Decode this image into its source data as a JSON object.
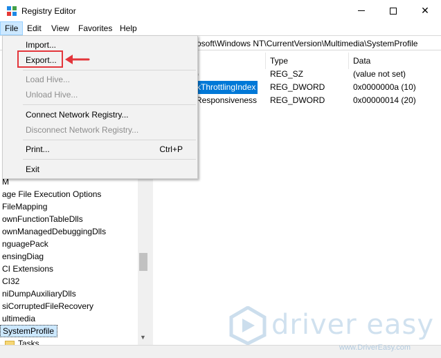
{
  "window": {
    "title": "Registry Editor",
    "minimize_icon": "minimize-icon",
    "maximize_icon": "maximize-icon",
    "close_icon": "close-icon",
    "close_glyph": "✕"
  },
  "menubar": {
    "file": "File",
    "edit": "Edit",
    "view": "View",
    "favorites": "Favorites",
    "help": "Help"
  },
  "address": {
    "path": "rosoft\\Windows NT\\CurrentVersion\\Multimedia\\SystemProfile"
  },
  "file_menu": {
    "items": [
      {
        "label": "Import...",
        "enabled": true
      },
      {
        "label": "Export...",
        "enabled": true
      },
      {
        "label": "Load Hive...",
        "enabled": false
      },
      {
        "label": "Unload Hive...",
        "enabled": false
      },
      {
        "label": "Connect Network Registry...",
        "enabled": true
      },
      {
        "label": "Disconnect Network Registry...",
        "enabled": false
      },
      {
        "label": "Print...",
        "enabled": true,
        "shortcut": "Ctrl+P"
      },
      {
        "label": "Exit",
        "enabled": true
      }
    ],
    "highlight_color": "#e3353b"
  },
  "tree": {
    "items": [
      "M",
      "age File Execution Options",
      "FileMapping",
      "ownFunctionTableDlls",
      "ownManagedDebuggingDlls",
      "nguagePack",
      "ensingDiag",
      "CI Extensions",
      "CI32",
      "niDumpAuxiliaryDlls",
      "siCorruptedFileRecovery",
      "ultimedia",
      "SystemProfile",
      "Tasks"
    ],
    "selected": "SystemProfile"
  },
  "list": {
    "headers": {
      "name": "",
      "type": "Type",
      "data": "Data"
    },
    "rows": [
      {
        "name": ")",
        "type": "REG_SZ",
        "data": "(value not set)"
      },
      {
        "name": "kThrottlingIndex",
        "type": "REG_DWORD",
        "data": "0x0000000a (10)"
      },
      {
        "name": "Responsiveness",
        "type": "REG_DWORD",
        "data": "0x00000014 (20)"
      }
    ]
  },
  "watermark": {
    "brand": "driver easy",
    "url": "www.DriverEasy.com"
  }
}
